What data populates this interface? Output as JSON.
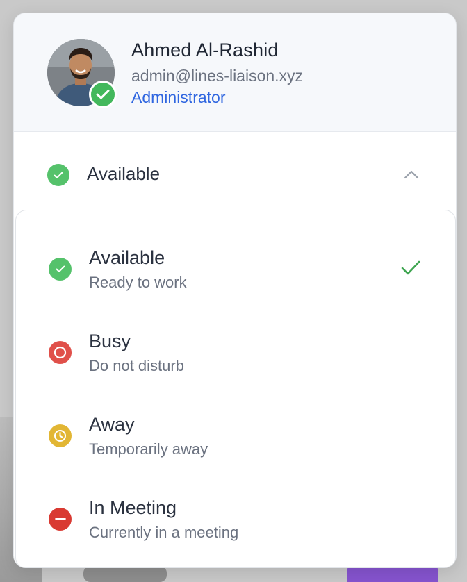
{
  "profile": {
    "name": "Ahmed Al-Rashid",
    "email": "admin@lines-liaison.xyz",
    "role": "Administrator",
    "avatar_icon": "person-avatar",
    "badge_icon": "check-icon",
    "badge_color": "#43b85c",
    "role_color": "#2f66e0"
  },
  "current_status": {
    "label": "Available",
    "icon": "check-circle-icon",
    "color": "#55c26b",
    "expanded": true,
    "toggle_icon": "chevron-up-icon"
  },
  "status_options": [
    {
      "title": "Available",
      "subtitle": "Ready to work",
      "icon": "check-circle-icon",
      "color": "#55c26b",
      "selected": true
    },
    {
      "title": "Busy",
      "subtitle": "Do not disturb",
      "icon": "ring-circle-icon",
      "color": "#e0504a",
      "selected": false
    },
    {
      "title": "Away",
      "subtitle": "Temporarily away",
      "icon": "clock-icon",
      "color": "#e2b634",
      "selected": false
    },
    {
      "title": "In Meeting",
      "subtitle": "Currently in a meeting",
      "icon": "minus-circle-icon",
      "color": "#d93a32",
      "selected": false
    }
  ]
}
